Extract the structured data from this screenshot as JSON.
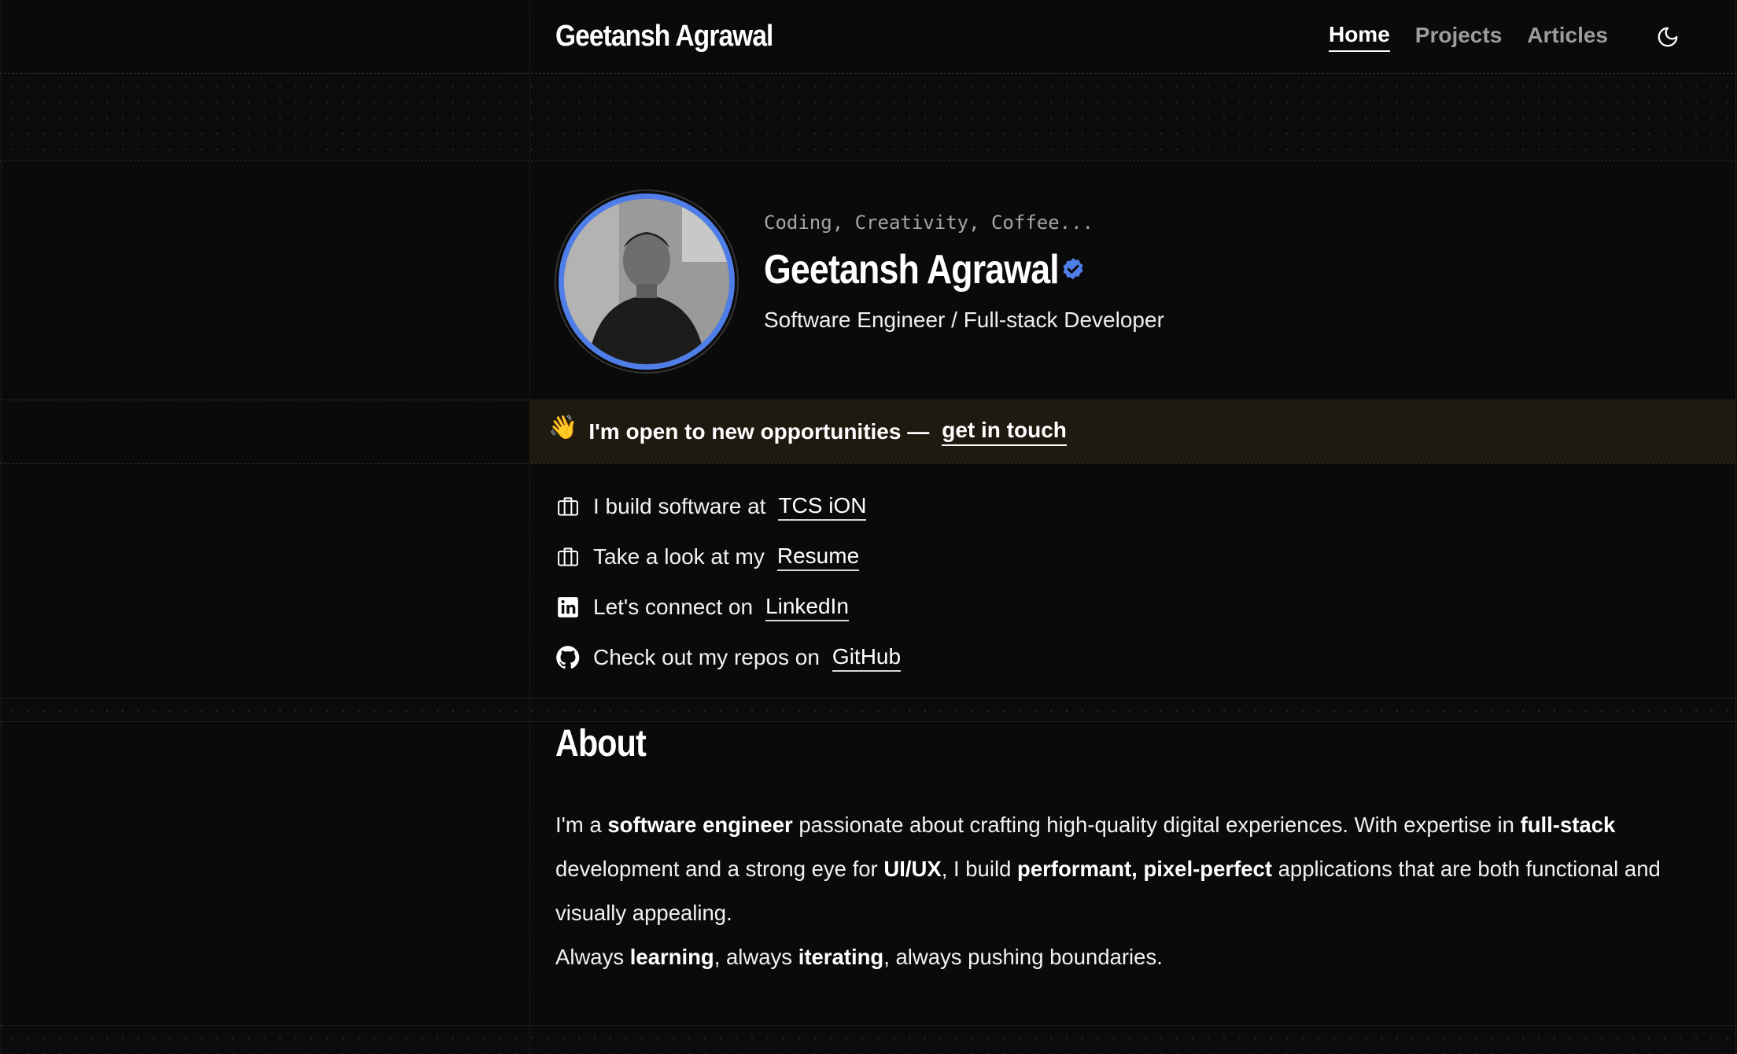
{
  "header": {
    "brand": "Geetansh Agrawal",
    "nav": [
      {
        "label": "Home",
        "active": true
      },
      {
        "label": "Projects",
        "active": false
      },
      {
        "label": "Articles",
        "active": false
      }
    ],
    "theme_icon": "moon-icon"
  },
  "profile": {
    "tagline": "Coding, Creativity, Coffee...",
    "name": "Geetansh Agrawal",
    "verified_icon": "verified-badge-icon",
    "role": "Software Engineer / Full-stack Developer",
    "ring_color": "#4f7ee8"
  },
  "banner": {
    "emoji": "👋",
    "text": "I'm open to new opportunities —",
    "link": "get in touch",
    "bg_color": "#1f1a10"
  },
  "links": [
    {
      "icon": "briefcase-icon",
      "text": "I build software at",
      "link": "TCS iON"
    },
    {
      "icon": "briefcase-icon",
      "text": "Take a look at my",
      "link": "Resume"
    },
    {
      "icon": "linkedin-icon",
      "text": "Let's connect on",
      "link": "LinkedIn"
    },
    {
      "icon": "github-icon",
      "text": "Check out my repos on",
      "link": "GitHub"
    }
  ],
  "about": {
    "title": "About",
    "p1": [
      {
        "t": "I'm a ",
        "b": false
      },
      {
        "t": "software engineer",
        "b": true
      },
      {
        "t": " passionate about crafting high-quality digital experiences. With expertise in ",
        "b": false
      },
      {
        "t": "full-stack",
        "b": true
      },
      {
        "t": " development and a strong eye for ",
        "b": false
      },
      {
        "t": "UI/UX",
        "b": true
      },
      {
        "t": ", I build ",
        "b": false
      },
      {
        "t": "performant, pixel-perfect",
        "b": true
      },
      {
        "t": " applications that are both functional and visually appealing.",
        "b": false
      }
    ],
    "p2": [
      {
        "t": "Always ",
        "b": false
      },
      {
        "t": "learning",
        "b": true
      },
      {
        "t": ", always ",
        "b": false
      },
      {
        "t": "iterating",
        "b": true
      },
      {
        "t": ", always pushing boundaries.",
        "b": false
      }
    ]
  }
}
